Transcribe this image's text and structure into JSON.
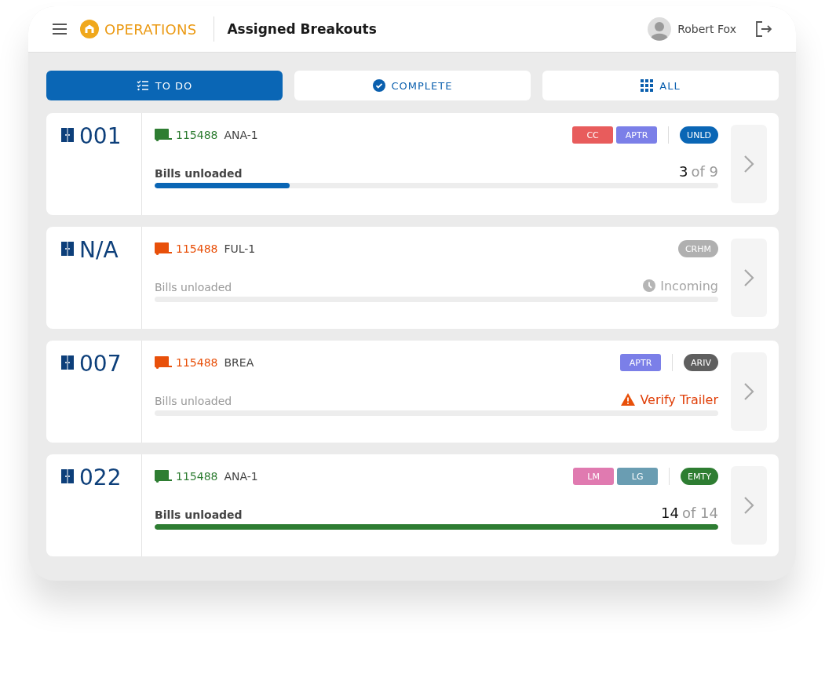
{
  "header": {
    "brand": "OPERATIONS",
    "title": "Assigned Breakouts",
    "user": {
      "name": "Robert Fox"
    }
  },
  "tabs": [
    {
      "label": "TO DO",
      "selected": true
    },
    {
      "label": "COMPLETE",
      "selected": false
    },
    {
      "label": "ALL",
      "selected": false
    }
  ],
  "cards": [
    {
      "door": "001",
      "trailer": {
        "number": "115488",
        "color": "#2e7d32"
      },
      "location": "ANA-1",
      "tags": [
        {
          "label": "CC",
          "color": "#e85c5c"
        },
        {
          "label": "APTR",
          "color": "#7b7fe8"
        }
      ],
      "status": {
        "label": "UNLD",
        "color": "#0a66b5"
      },
      "progress_label": "Bills unloaded",
      "active": true,
      "progress": {
        "kind": "count",
        "done": "3",
        "total": "of 9",
        "level": 0.24
      }
    },
    {
      "door": "N/A",
      "trailer": {
        "number": "115488",
        "color": "#e8500a"
      },
      "location": "FUL-1",
      "status": {
        "label": "CRHM",
        "color": "#b0b0b0"
      },
      "progress_label": "Bills unloaded",
      "active": false,
      "progress": {
        "kind": "incoming",
        "text": "Incoming"
      }
    },
    {
      "door": "007",
      "trailer": {
        "number": "115488",
        "color": "#e8500a"
      },
      "location": "BREA",
      "tags": [
        {
          "label": "APTR",
          "color": "#7b7fe8"
        }
      ],
      "status": {
        "label": "ARIV",
        "color": "#5f5f5f"
      },
      "progress_label": "Bills unloaded",
      "active": false,
      "progress": {
        "kind": "warning",
        "text": "Verify Trailer"
      }
    },
    {
      "door": "022",
      "trailer": {
        "number": "115488",
        "color": "#2e7d32"
      },
      "location": "ANA-1",
      "tags": [
        {
          "label": "LM",
          "color": "#e07ab0"
        },
        {
          "label": "LG",
          "color": "#6a9db2"
        }
      ],
      "status": {
        "label": "EMTY",
        "color": "#2e7d32"
      },
      "progress_label": "Bills unloaded",
      "active": true,
      "progress": {
        "kind": "count",
        "done": "14",
        "total": "of 14",
        "level": 1
      }
    }
  ]
}
